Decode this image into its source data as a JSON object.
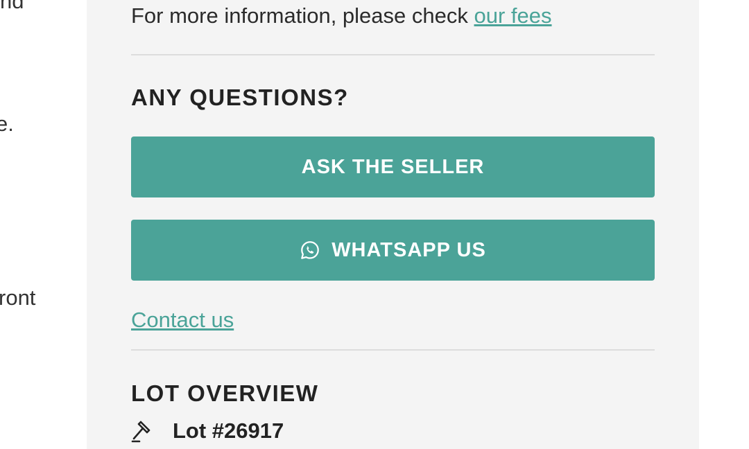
{
  "left_column": {
    "fragment_1": "nd",
    "fragment_2": "e.",
    "fragment_3": "ront"
  },
  "fees": {
    "text": "For more information, please check ",
    "link_label": "our fees"
  },
  "questions": {
    "heading": "ANY QUESTIONS?",
    "ask_seller_label": "ASK THE SELLER",
    "whatsapp_label": "WHATSAPP US",
    "contact_link_label": "Contact us"
  },
  "lot_overview": {
    "heading": "LOT OVERVIEW",
    "lot_number": "Lot #26917"
  },
  "icons": {
    "whatsapp": "whatsapp-icon",
    "gavel": "gavel-icon"
  },
  "colors": {
    "accent": "#4ba398",
    "panel_bg": "#f4f4f4",
    "text": "#222222",
    "divider": "#dcdcdc"
  }
}
